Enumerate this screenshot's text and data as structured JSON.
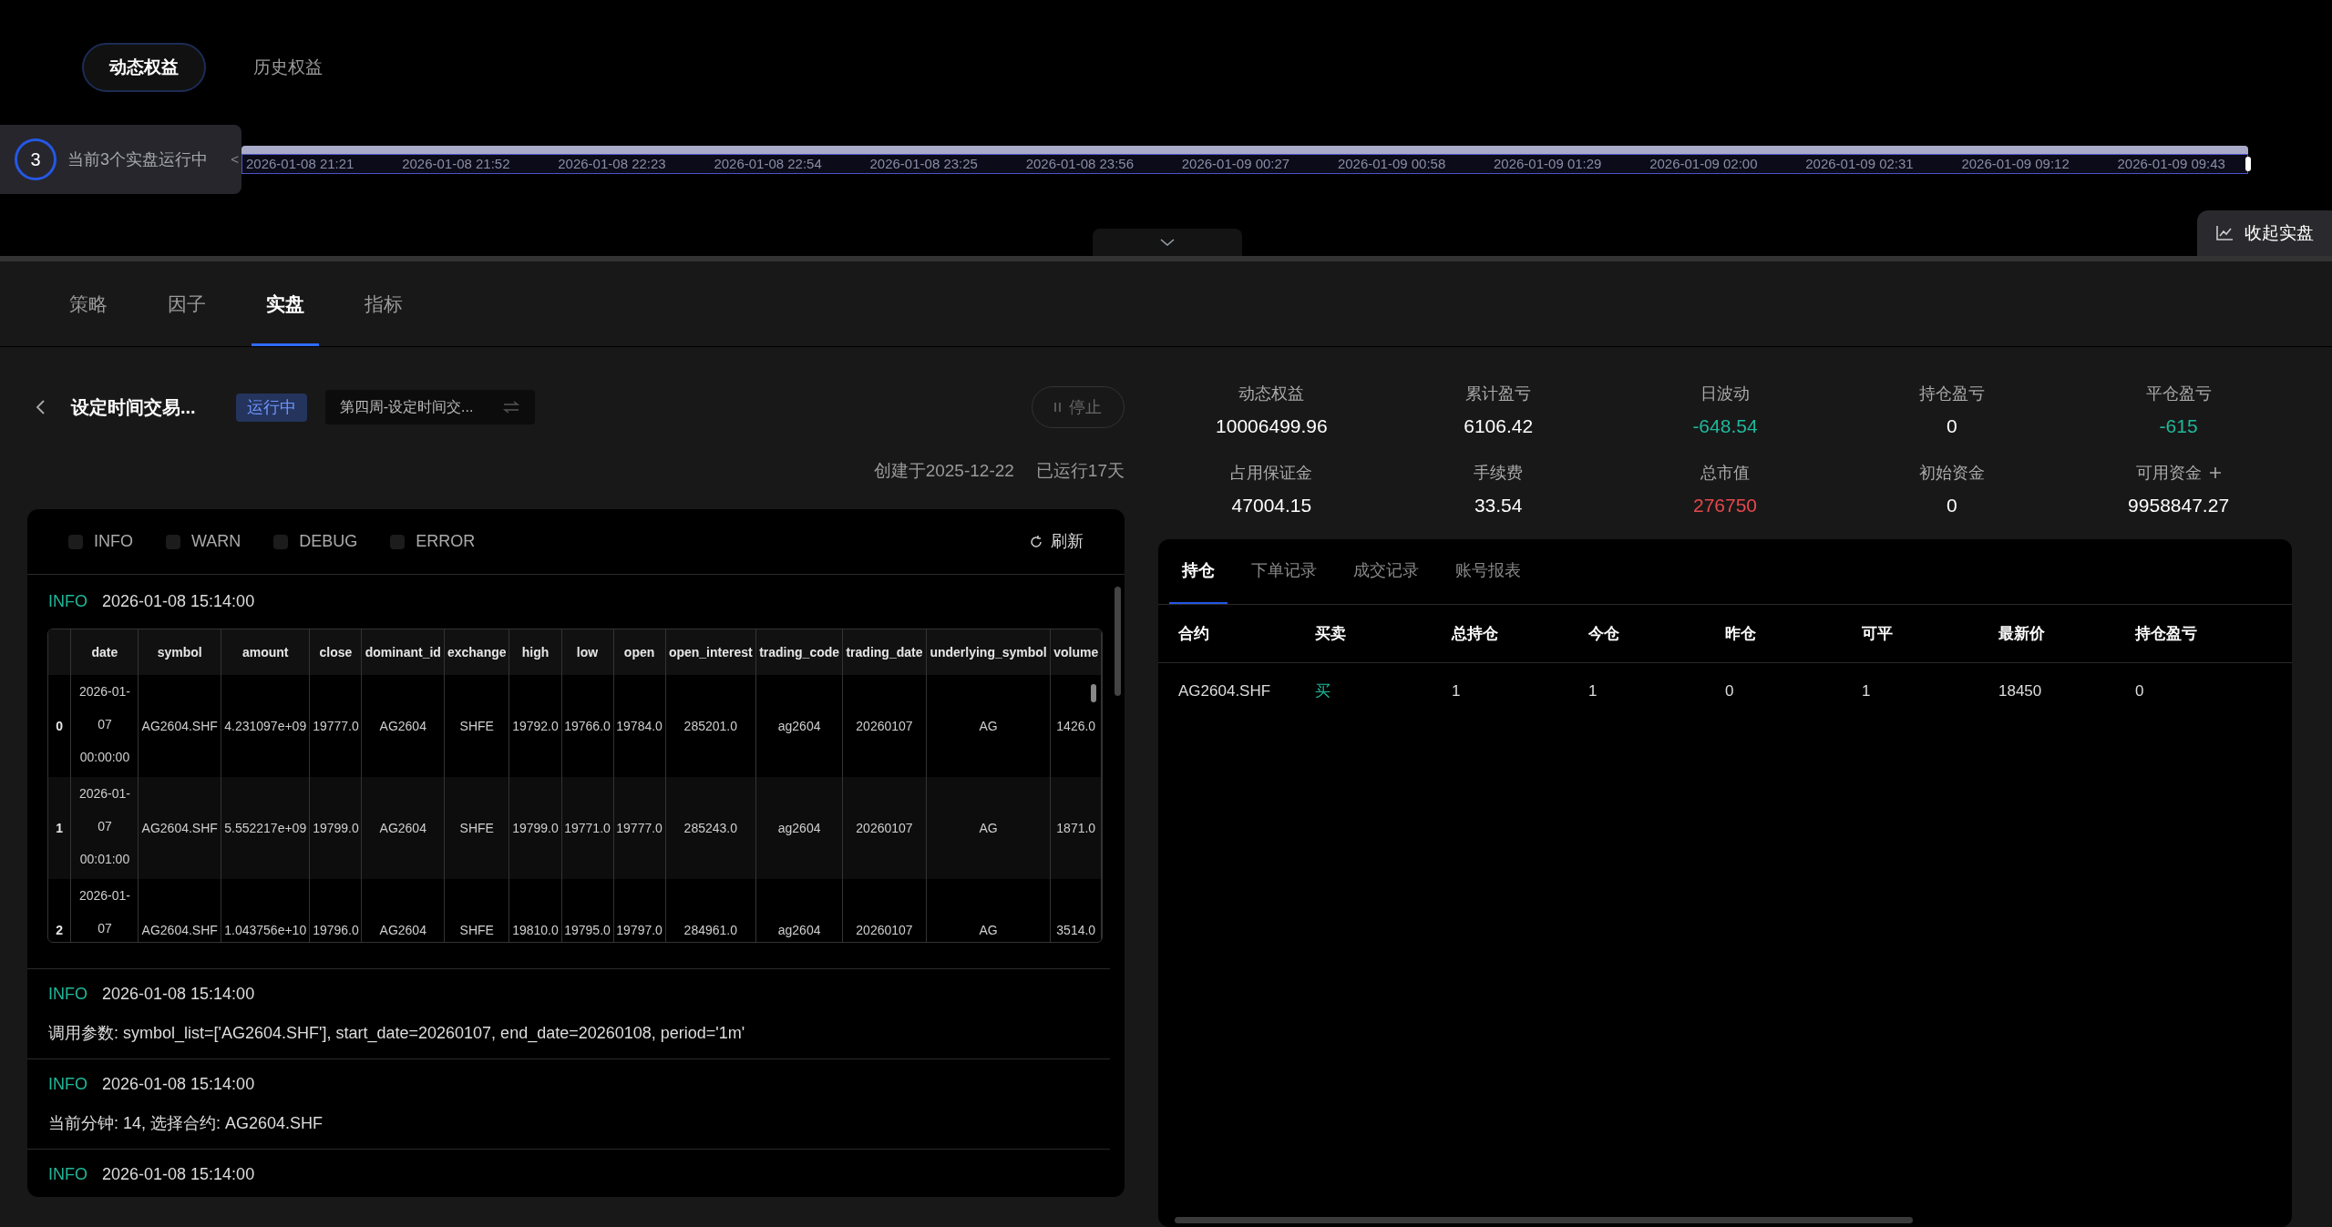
{
  "equity_tabs": [
    {
      "label": "动态权益",
      "selected": true
    },
    {
      "label": "历史权益",
      "selected": false
    }
  ],
  "running_badge": {
    "count": "3",
    "text": "当前3个实盘运行中",
    "collapse_glyph": "<"
  },
  "timeline": {
    "labels": [
      "2026-01-08 21:21",
      "2026-01-08 21:52",
      "2026-01-08 22:23",
      "2026-01-08 22:54",
      "2026-01-08 23:25",
      "2026-01-08 23:56",
      "2026-01-09 00:27",
      "2026-01-09 00:58",
      "2026-01-09 01:29",
      "2026-01-09 02:00",
      "2026-01-09 02:31",
      "2026-01-09 09:12",
      "2026-01-09 09:43"
    ]
  },
  "collapse_button": {
    "label": "收起实盘"
  },
  "main_tabs": [
    {
      "label": "策略",
      "selected": false
    },
    {
      "label": "因子",
      "selected": false
    },
    {
      "label": "实盘",
      "selected": true
    },
    {
      "label": "指标",
      "selected": false
    }
  ],
  "strategy": {
    "name": "设定时间交易...",
    "status": "运行中",
    "selector": "第四周-设定时间交...",
    "stop_button": "停止",
    "created": "创建于2025-12-22",
    "running_days": "已运行17天"
  },
  "log_filters": [
    {
      "label": "INFO",
      "checked": false
    },
    {
      "label": "WARN",
      "checked": false
    },
    {
      "label": "DEBUG",
      "checked": false
    },
    {
      "label": "ERROR",
      "checked": false
    }
  ],
  "refresh_button": "刷新",
  "logs": [
    {
      "kind": "table",
      "level": "INFO",
      "time": "2026-01-08 15:14:00",
      "columns": [
        "",
        "date",
        "symbol",
        "amount",
        "close",
        "dominant_id",
        "exchange",
        "high",
        "low",
        "open",
        "open_interest",
        "trading_code",
        "trading_date",
        "underlying_symbol",
        "volume"
      ],
      "rows": [
        [
          "0",
          "2026-01-07 00:00:00",
          "AG2604.SHF",
          "4.231097e+09",
          "19777.0",
          "AG2604",
          "SHFE",
          "19792.0",
          "19766.0",
          "19784.0",
          "285201.0",
          "ag2604",
          "20260107",
          "AG",
          "1426.0"
        ],
        [
          "1",
          "2026-01-07 00:01:00",
          "AG2604.SHF",
          "5.552217e+09",
          "19799.0",
          "AG2604",
          "SHFE",
          "19799.0",
          "19771.0",
          "19777.0",
          "285243.0",
          "ag2604",
          "20260107",
          "AG",
          "1871.0"
        ],
        [
          "2",
          "2026-01-07",
          "AG2604.SHF",
          "1.043756e+10",
          "19796.0",
          "AG2604",
          "SHFE",
          "19810.0",
          "19795.0",
          "19797.0",
          "284961.0",
          "ag2604",
          "20260107",
          "AG",
          "3514.0"
        ]
      ]
    },
    {
      "kind": "text",
      "level": "INFO",
      "time": "2026-01-08 15:14:00",
      "message": "调用参数: symbol_list=['AG2604.SHF'], start_date=20260107, end_date=20260108, period='1m'"
    },
    {
      "kind": "text",
      "level": "INFO",
      "time": "2026-01-08 15:14:00",
      "message": "当前分钟: 14, 选择合约: AG2604.SHF"
    },
    {
      "kind": "text",
      "level": "INFO",
      "time": "2026-01-08 15:14:00"
    }
  ],
  "stats": [
    {
      "label": "动态权益",
      "value": "10006499.96",
      "color": "#ffffff"
    },
    {
      "label": "累计盈亏",
      "value": "6106.42",
      "color": "#ffffff"
    },
    {
      "label": "日波动",
      "value": "-648.54",
      "color": "#1fb89a"
    },
    {
      "label": "持仓盈亏",
      "value": "0",
      "color": "#ffffff"
    },
    {
      "label": "平仓盈亏",
      "value": "-615",
      "color": "#1fb89a"
    },
    {
      "label": "占用保证金",
      "value": "47004.15",
      "color": "#ffffff"
    },
    {
      "label": "手续费",
      "value": "33.54",
      "color": "#ffffff"
    },
    {
      "label": "总市值",
      "value": "276750",
      "color": "#e5484d"
    },
    {
      "label": "初始资金",
      "value": "0",
      "color": "#ffffff"
    },
    {
      "label": "可用资金",
      "value": "9958847.27",
      "color": "#ffffff",
      "has_add": true
    }
  ],
  "account_tabs": [
    {
      "label": "持仓",
      "selected": true
    },
    {
      "label": "下单记录",
      "selected": false
    },
    {
      "label": "成交记录",
      "selected": false
    },
    {
      "label": "账号报表",
      "selected": false
    }
  ],
  "positions": {
    "columns": [
      "合约",
      "买卖",
      "总持仓",
      "今仓",
      "昨仓",
      "可平",
      "最新价",
      "持仓盈亏"
    ],
    "rows": [
      {
        "cells": [
          "AG2604.SHF",
          "买",
          "1",
          "1",
          "0",
          "1",
          "18450",
          "0"
        ],
        "color": "#1fb89a"
      }
    ]
  }
}
